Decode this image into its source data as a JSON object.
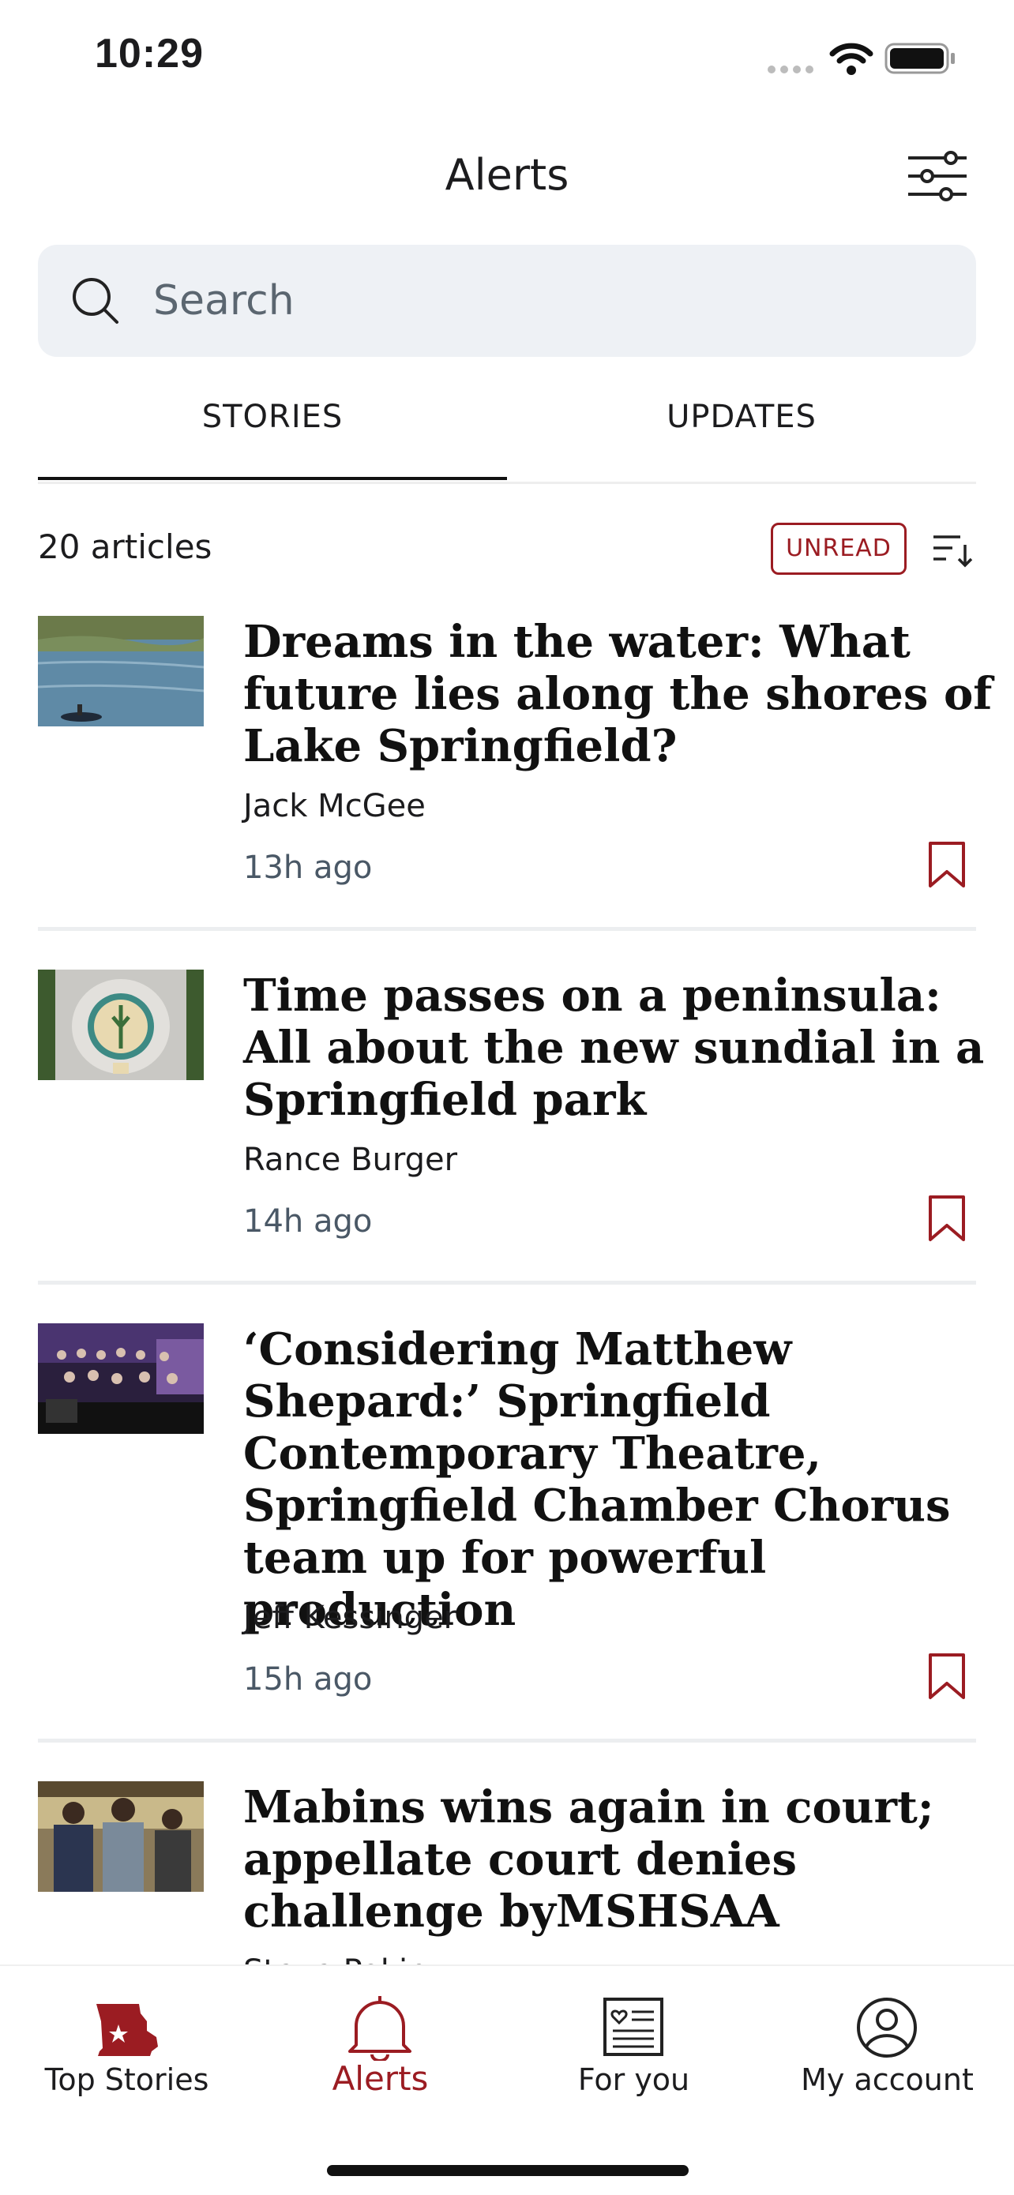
{
  "status_bar": {
    "time": "10:29"
  },
  "header": {
    "title": "Alerts"
  },
  "search": {
    "placeholder": "Search"
  },
  "tabs": [
    {
      "label": "STORIES",
      "active": true
    },
    {
      "label": "UPDATES",
      "active": false
    }
  ],
  "list_meta": {
    "count_label": "20 articles",
    "filter_label": "UNREAD"
  },
  "articles": [
    {
      "title": "Dreams in the water: What future lies along the shores of Lake Springfield?",
      "author": "Jack McGee",
      "time": "13h ago"
    },
    {
      "title": "Time passes on a peninsula: All about the new sundial in a Springfield park",
      "author": "Rance Burger",
      "time": "14h ago"
    },
    {
      "title": "‘Considering Matthew Shepard:’ Springfield Contemporary Theatre, Springfield Chamber Chorus team up for powerful production",
      "author": "Jeff Kessinger",
      "time": "15h ago"
    },
    {
      "title": "Mabins wins again in court; appellate court denies challenge byMSHSAA",
      "author": "Steve Pokin",
      "time": ""
    }
  ],
  "tab_bar": [
    {
      "label": "Top Stories",
      "icon": "missouri-star-icon"
    },
    {
      "label": "Alerts",
      "icon": "bell-icon",
      "active": true
    },
    {
      "label": "For you",
      "icon": "newspaper-heart-icon"
    },
    {
      "label": "My account",
      "icon": "account-circle-icon"
    }
  ],
  "colors": {
    "accent": "#9b1c22",
    "search_bg": "#eef1f5",
    "meta_text": "#4a5866"
  }
}
